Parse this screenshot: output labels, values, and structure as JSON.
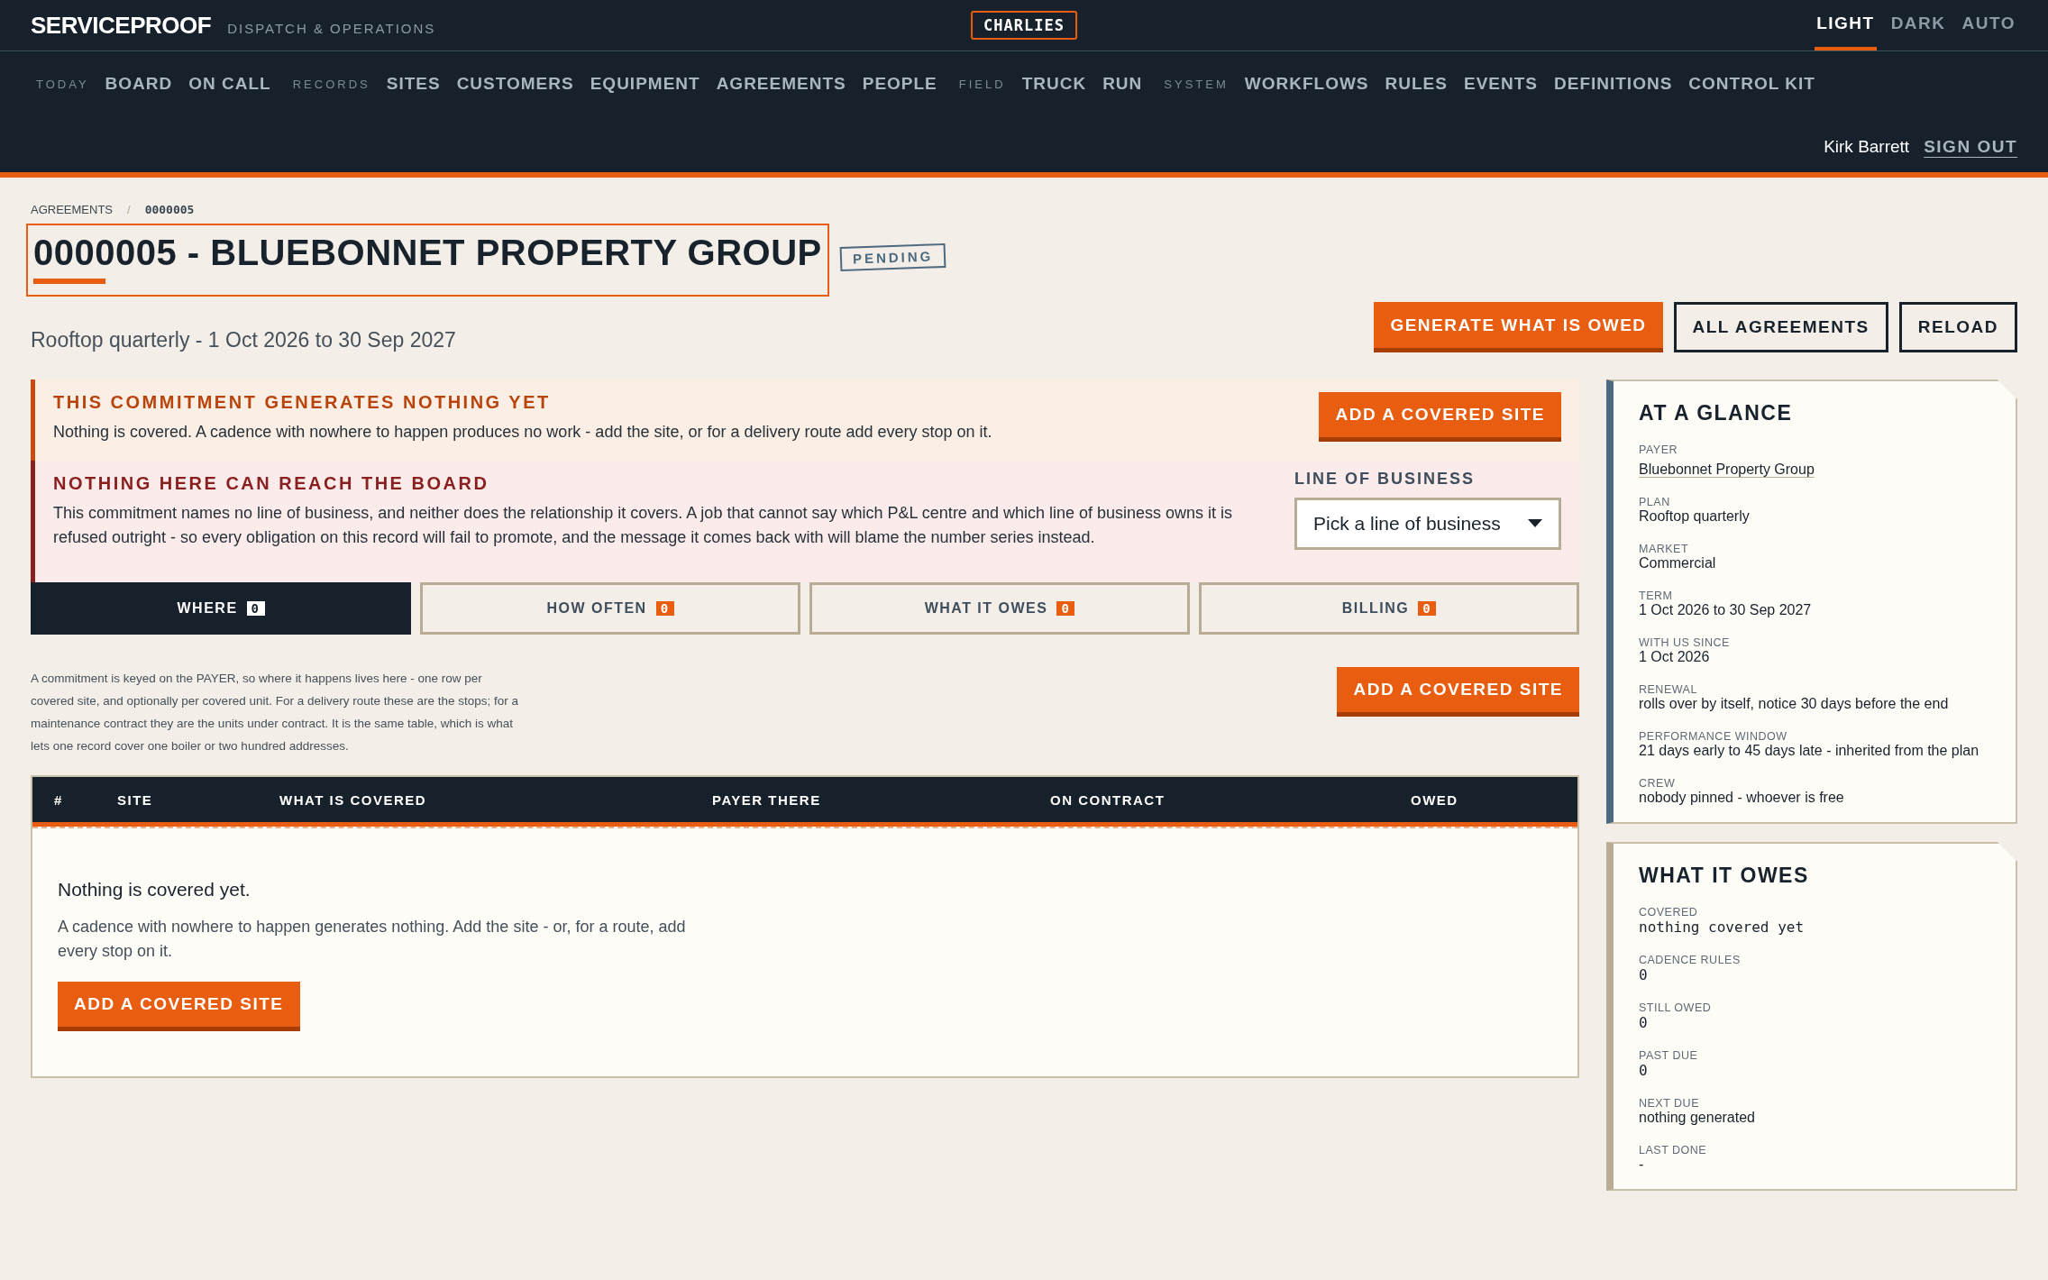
{
  "topbar": {
    "brand": "SERVICEPROOF",
    "tagline": "DISPATCH & OPERATIONS",
    "tenant": "CHARLIES",
    "themes": [
      {
        "label": "LIGHT",
        "selected": true
      },
      {
        "label": "DARK",
        "selected": false
      },
      {
        "label": "AUTO",
        "selected": false
      }
    ]
  },
  "nav": [
    {
      "kind": "section",
      "label": "TODAY"
    },
    {
      "kind": "link",
      "label": "BOARD"
    },
    {
      "kind": "link",
      "label": "ON CALL"
    },
    {
      "kind": "section",
      "label": "RECORDS"
    },
    {
      "kind": "link",
      "label": "SITES"
    },
    {
      "kind": "link",
      "label": "CUSTOMERS"
    },
    {
      "kind": "link",
      "label": "EQUIPMENT"
    },
    {
      "kind": "link",
      "label": "AGREEMENTS"
    },
    {
      "kind": "link",
      "label": "PEOPLE"
    },
    {
      "kind": "section",
      "label": "FIELD"
    },
    {
      "kind": "link",
      "label": "TRUCK"
    },
    {
      "kind": "link",
      "label": "RUN"
    },
    {
      "kind": "section",
      "label": "SYSTEM"
    },
    {
      "kind": "link",
      "label": "WORKFLOWS"
    },
    {
      "kind": "link",
      "label": "RULES"
    },
    {
      "kind": "link",
      "label": "EVENTS"
    },
    {
      "kind": "link",
      "label": "DEFINITIONS"
    },
    {
      "kind": "link",
      "label": "CONTROL KIT"
    }
  ],
  "user": {
    "name": "Kirk Barrett",
    "sign_out": "SIGN OUT"
  },
  "breadcrumb": [
    "AGREEMENTS",
    "/",
    "0000005"
  ],
  "title": "0000005 - BLUEBONNET PROPERTY GROUP",
  "status": "PENDING",
  "subtitle": "Rooftop quarterly - 1 Oct 2026 to 30 Sep 2027",
  "actions": [
    {
      "kind": "primary",
      "label": "GENERATE WHAT IS OWED"
    },
    {
      "kind": "secondary",
      "label": "ALL AGREEMENTS"
    },
    {
      "kind": "secondary",
      "label": "RELOAD"
    }
  ],
  "alerts": [
    {
      "kind": "warning",
      "title": "THIS COMMITMENT GENERATES NOTHING YET",
      "text": "Nothing is covered. A cadence with nowhere to happen produces no work - add the site, or for a delivery route add every stop on it.",
      "button": "ADD A COVERED SITE"
    },
    {
      "kind": "error",
      "title": "NOTHING HERE CAN REACH THE BOARD",
      "text": "This commitment names no line of business, and neither does the relationship it covers. A job that cannot say which P&L centre and which line of business owns it is refused outright - so every obligation on this record will fail to promote, and the message it comes back with will blame the number series instead.",
      "field_label": "LINE OF BUSINESS",
      "field_value": "Pick a line of business"
    }
  ],
  "tabs": [
    {
      "label": "WHERE",
      "count": "0",
      "selected": true
    },
    {
      "label": "HOW OFTEN",
      "count": "0",
      "selected": false
    },
    {
      "label": "WHAT IT OWES",
      "count": "0",
      "selected": false
    },
    {
      "label": "BILLING",
      "count": "0",
      "selected": false
    }
  ],
  "intro": "A commitment is keyed on the PAYER, so where it happens lives here - one row per covered site, and optionally per covered unit. For a delivery route these are the stops; for a maintenance contract they are the units under contract. It is the same table, which is what lets one record cover one boiler or two hundred addresses.",
  "intro_button": "ADD A COVERED SITE",
  "table": {
    "columns": [
      "#",
      "SITE",
      "WHAT IS COVERED",
      "PAYER THERE",
      "ON CONTRACT",
      "OWED"
    ],
    "empty": {
      "title": "Nothing is covered yet.",
      "text": "A cadence with nowhere to happen generates nothing. Add the site - or, for a route, add every stop on it.",
      "button": "ADD A COVERED SITE"
    }
  },
  "glance": {
    "title": "AT A GLANCE",
    "fields": [
      {
        "label": "PAYER",
        "value": "Bluebonnet Property Group",
        "kind": "link"
      },
      {
        "label": "PLAN",
        "value": "Rooftop quarterly",
        "kind": "text"
      },
      {
        "label": "MARKET",
        "value": "Commercial",
        "kind": "text"
      },
      {
        "label": "TERM",
        "value": "1 Oct 2026 to 30 Sep 2027",
        "kind": "text"
      },
      {
        "label": "WITH US SINCE",
        "value": "1 Oct 2026",
        "kind": "text"
      },
      {
        "label": "RENEWAL",
        "value": "rolls over by itself, notice 30 days before the end",
        "kind": "text"
      },
      {
        "label": "PERFORMANCE WINDOW",
        "value": "21 days early to 45 days late - inherited from the plan",
        "kind": "text"
      },
      {
        "label": "CREW",
        "value": "nobody pinned - whoever is free",
        "kind": "text"
      }
    ]
  },
  "owes": {
    "title": "WHAT IT OWES",
    "fields": [
      {
        "label": "COVERED",
        "value": "nothing covered yet",
        "kind": "mono"
      },
      {
        "label": "CADENCE RULES",
        "value": "0",
        "kind": "mono"
      },
      {
        "label": "STILL OWED",
        "value": "0",
        "kind": "mono"
      },
      {
        "label": "PAST DUE",
        "value": "0",
        "kind": "mono"
      },
      {
        "label": "NEXT DUE",
        "value": "nothing generated",
        "kind": "text"
      },
      {
        "label": "LAST DONE",
        "value": "-",
        "kind": "text"
      }
    ]
  }
}
